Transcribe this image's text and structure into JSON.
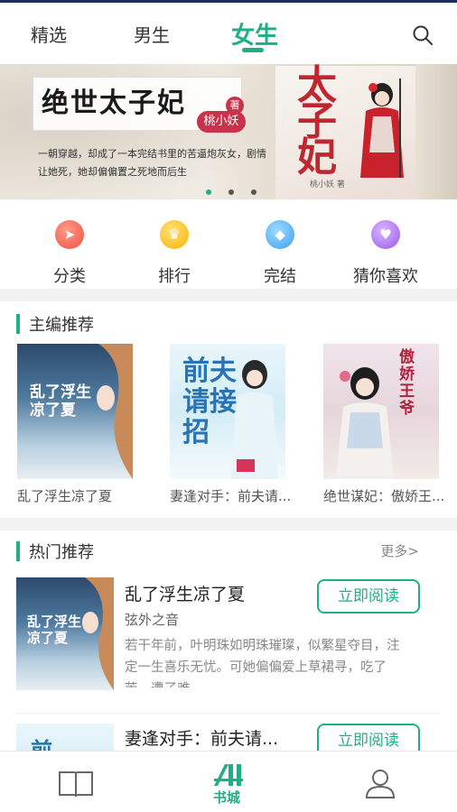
{
  "colors": {
    "accent": "#1fae85",
    "topline": "#1b2e5e"
  },
  "tabs": [
    {
      "label": "精选"
    },
    {
      "label": "男生"
    },
    {
      "label": "女生",
      "active": true
    }
  ],
  "banner": {
    "title": "绝世太子妃",
    "seal": "著",
    "author": "桃小妖",
    "description": "一朝穿越，却成了一本完结书里的苦逼炮灰女，剧情让她死，她却偏偏置之死地而后生",
    "cover_title": "太子妃",
    "cover_author": "桃小妖 著",
    "slide_count": 3,
    "active_slide": 0
  },
  "quick_entries": [
    {
      "label": "分类",
      "icon": "rocket-icon"
    },
    {
      "label": "排行",
      "icon": "crown-icon"
    },
    {
      "label": "完结",
      "icon": "tag-icon"
    },
    {
      "label": "猜你喜欢",
      "icon": "heart-icon"
    }
  ],
  "editor_section": {
    "title": "主编推荐",
    "books": [
      {
        "name": "乱了浮生凉了夏",
        "cover_text": "乱了浮生凉了夏"
      },
      {
        "name": "妻逢对手：前夫请...",
        "cover_text": "前夫请接招"
      },
      {
        "name": "绝世谋妃：傲娇王...",
        "cover_text": "傲娇王爷"
      }
    ]
  },
  "hot_section": {
    "title": "热门推荐",
    "more": "更多>",
    "items": [
      {
        "title": "乱了浮生凉了夏",
        "author": "弦外之音",
        "description": "若干年前，叶明珠如明珠璀璨，似繁星夺目，注定一生喜乐无忧。可她偏偏爱上草裙寻，吃了苦，遭了难",
        "button": "立即阅读"
      },
      {
        "title": "妻逢对手：前夫请...",
        "button": "立即阅读"
      }
    ]
  },
  "bottom_nav": {
    "bookstore_label": "书城"
  }
}
